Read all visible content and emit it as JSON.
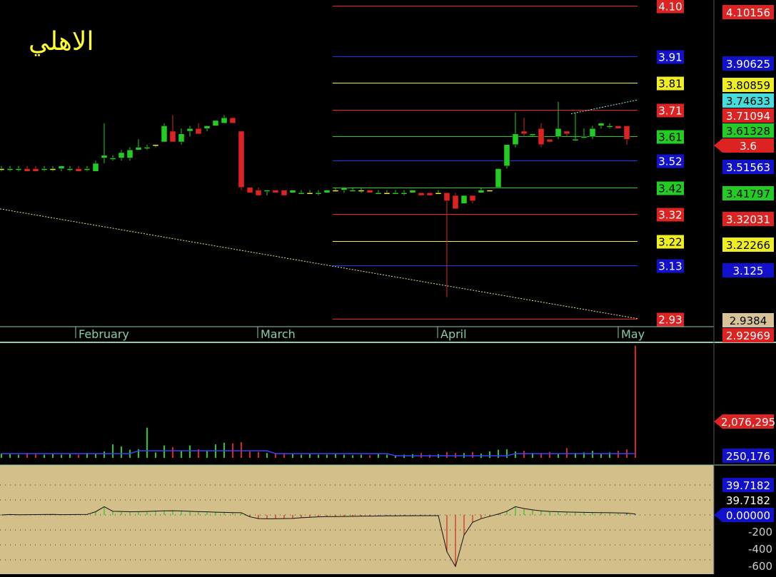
{
  "title": "الاهلي",
  "colors": {
    "up": "#22cc22",
    "down": "#dd2222",
    "axis": "#88ccaa",
    "panel_bg": "#000000",
    "osc_bg": "#d2bf8a",
    "blue": "#1111cc",
    "green": "#22cc22",
    "red": "#dd2222",
    "yellow": "#eeee22",
    "cyan": "#44dddd",
    "tan": "#d7c29a"
  },
  "chart_data": [
    {
      "type": "candlestick",
      "name": "price",
      "ylim": [
        2.9,
        4.12
      ],
      "x_labels": [
        "February",
        "March",
        "April",
        "May"
      ],
      "candles": [
        {
          "o": 3.49,
          "h": 3.5,
          "l": 3.48,
          "c": 3.49
        },
        {
          "o": 3.49,
          "h": 3.5,
          "l": 3.48,
          "c": 3.49
        },
        {
          "o": 3.49,
          "h": 3.5,
          "l": 3.48,
          "c": 3.49
        },
        {
          "o": 3.49,
          "h": 3.5,
          "l": 3.48,
          "c": 3.48
        },
        {
          "o": 3.49,
          "h": 3.5,
          "l": 3.48,
          "c": 3.48
        },
        {
          "o": 3.49,
          "h": 3.5,
          "l": 3.48,
          "c": 3.49
        },
        {
          "o": 3.49,
          "h": 3.5,
          "l": 3.48,
          "c": 3.49
        },
        {
          "o": 3.49,
          "h": 3.5,
          "l": 3.48,
          "c": 3.5
        },
        {
          "o": 3.49,
          "h": 3.5,
          "l": 3.48,
          "c": 3.49
        },
        {
          "o": 3.49,
          "h": 3.5,
          "l": 3.48,
          "c": 3.48
        },
        {
          "o": 3.49,
          "h": 3.5,
          "l": 3.48,
          "c": 3.49
        },
        {
          "o": 3.48,
          "h": 3.52,
          "l": 3.48,
          "c": 3.51
        },
        {
          "o": 3.53,
          "h": 3.66,
          "l": 3.51,
          "c": 3.54
        },
        {
          "o": 3.53,
          "h": 3.54,
          "l": 3.52,
          "c": 3.53
        },
        {
          "o": 3.53,
          "h": 3.56,
          "l": 3.52,
          "c": 3.55
        },
        {
          "o": 3.53,
          "h": 3.57,
          "l": 3.52,
          "c": 3.56
        },
        {
          "o": 3.56,
          "h": 3.6,
          "l": 3.56,
          "c": 3.57
        },
        {
          "o": 3.57,
          "h": 3.58,
          "l": 3.56,
          "c": 3.57
        },
        {
          "o": 3.58,
          "h": 3.58,
          "l": 3.57,
          "c": 3.58
        },
        {
          "o": 3.59,
          "h": 3.66,
          "l": 3.59,
          "c": 3.65
        },
        {
          "o": 3.63,
          "h": 3.69,
          "l": 3.61,
          "c": 3.59
        },
        {
          "o": 3.59,
          "h": 3.64,
          "l": 3.58,
          "c": 3.62
        },
        {
          "o": 3.63,
          "h": 3.65,
          "l": 3.61,
          "c": 3.64
        },
        {
          "o": 3.64,
          "h": 3.66,
          "l": 3.62,
          "c": 3.62
        },
        {
          "o": 3.64,
          "h": 3.65,
          "l": 3.63,
          "c": 3.65
        },
        {
          "o": 3.65,
          "h": 3.67,
          "l": 3.65,
          "c": 3.67
        },
        {
          "o": 3.66,
          "h": 3.69,
          "l": 3.66,
          "c": 3.68
        },
        {
          "o": 3.68,
          "h": 3.68,
          "l": 3.66,
          "c": 3.66
        },
        {
          "o": 3.63,
          "h": 3.63,
          "l": 3.41,
          "c": 3.42
        },
        {
          "o": 3.42,
          "h": 3.42,
          "l": 3.4,
          "c": 3.4
        },
        {
          "o": 3.41,
          "h": 3.42,
          "l": 3.39,
          "c": 3.39
        },
        {
          "o": 3.41,
          "h": 3.41,
          "l": 3.39,
          "c": 3.41
        },
        {
          "o": 3.41,
          "h": 3.41,
          "l": 3.4,
          "c": 3.4
        },
        {
          "o": 3.41,
          "h": 3.41,
          "l": 3.39,
          "c": 3.39
        },
        {
          "o": 3.4,
          "h": 3.41,
          "l": 3.4,
          "c": 3.41
        },
        {
          "o": 3.4,
          "h": 3.41,
          "l": 3.4,
          "c": 3.4
        },
        {
          "o": 3.4,
          "h": 3.41,
          "l": 3.4,
          "c": 3.4
        },
        {
          "o": 3.4,
          "h": 3.41,
          "l": 3.39,
          "c": 3.4
        },
        {
          "o": 3.4,
          "h": 3.41,
          "l": 3.4,
          "c": 3.41
        },
        {
          "o": 3.41,
          "h": 3.42,
          "l": 3.41,
          "c": 3.41
        },
        {
          "o": 3.41,
          "h": 3.42,
          "l": 3.4,
          "c": 3.42
        },
        {
          "o": 3.41,
          "h": 3.42,
          "l": 3.41,
          "c": 3.41
        },
        {
          "o": 3.41,
          "h": 3.42,
          "l": 3.4,
          "c": 3.41
        },
        {
          "o": 3.41,
          "h": 3.41,
          "l": 3.4,
          "c": 3.4
        },
        {
          "o": 3.4,
          "h": 3.41,
          "l": 3.4,
          "c": 3.4
        },
        {
          "o": 3.4,
          "h": 3.41,
          "l": 3.4,
          "c": 3.4
        },
        {
          "o": 3.4,
          "h": 3.41,
          "l": 3.4,
          "c": 3.4
        },
        {
          "o": 3.4,
          "h": 3.41,
          "l": 3.39,
          "c": 3.4
        },
        {
          "o": 3.4,
          "h": 3.41,
          "l": 3.4,
          "c": 3.41
        },
        {
          "o": 3.4,
          "h": 3.4,
          "l": 3.39,
          "c": 3.39
        },
        {
          "o": 3.4,
          "h": 3.4,
          "l": 3.39,
          "c": 3.39
        },
        {
          "o": 3.4,
          "h": 3.41,
          "l": 3.4,
          "c": 3.4
        },
        {
          "o": 3.4,
          "h": 3.4,
          "l": 3.01,
          "c": 3.37
        },
        {
          "o": 3.39,
          "h": 3.4,
          "l": 3.34,
          "c": 3.34
        },
        {
          "o": 3.36,
          "h": 3.39,
          "l": 3.36,
          "c": 3.39
        },
        {
          "o": 3.39,
          "h": 3.39,
          "l": 3.36,
          "c": 3.37
        },
        {
          "o": 3.4,
          "h": 3.42,
          "l": 3.4,
          "c": 3.41
        },
        {
          "o": 3.41,
          "h": 3.41,
          "l": 3.41,
          "c": 3.41
        },
        {
          "o": 3.42,
          "h": 3.49,
          "l": 3.42,
          "c": 3.49
        },
        {
          "o": 3.5,
          "h": 3.58,
          "l": 3.49,
          "c": 3.58
        },
        {
          "o": 3.58,
          "h": 3.7,
          "l": 3.57,
          "c": 3.62
        },
        {
          "o": 3.63,
          "h": 3.68,
          "l": 3.61,
          "c": 3.62
        },
        {
          "o": 3.62,
          "h": 3.62,
          "l": 3.61,
          "c": 3.62
        },
        {
          "o": 3.64,
          "h": 3.66,
          "l": 3.57,
          "c": 3.58
        },
        {
          "o": 3.6,
          "h": 3.6,
          "l": 3.59,
          "c": 3.59
        },
        {
          "o": 3.61,
          "h": 3.74,
          "l": 3.6,
          "c": 3.64
        },
        {
          "o": 3.63,
          "h": 3.63,
          "l": 3.61,
          "c": 3.62
        },
        {
          "o": 3.6,
          "h": 3.7,
          "l": 3.6,
          "c": 3.6
        },
        {
          "o": 3.61,
          "h": 3.64,
          "l": 3.61,
          "c": 3.61
        },
        {
          "o": 3.61,
          "h": 3.65,
          "l": 3.6,
          "c": 3.64
        },
        {
          "o": 3.65,
          "h": 3.66,
          "l": 3.64,
          "c": 3.66
        },
        {
          "o": 3.65,
          "h": 3.66,
          "l": 3.64,
          "c": 3.65
        },
        {
          "o": 3.65,
          "h": 3.65,
          "l": 3.64,
          "c": 3.64
        },
        {
          "o": 3.65,
          "h": 3.65,
          "l": 3.58,
          "c": 3.6
        }
      ],
      "levels": [
        {
          "label": "4.10",
          "color": "red"
        },
        {
          "label": "3.91",
          "color": "blue"
        },
        {
          "label": "3.81",
          "color": "yellow"
        },
        {
          "label": "3.71",
          "color": "red"
        },
        {
          "label": "3.61",
          "color": "green"
        },
        {
          "label": "3.52",
          "color": "blue"
        },
        {
          "label": "3.42",
          "color": "green"
        },
        {
          "label": "3.32",
          "color": "red"
        },
        {
          "label": "3.22",
          "color": "yellow"
        },
        {
          "label": "3.13",
          "color": "blue"
        },
        {
          "label": "2.93",
          "color": "red"
        }
      ],
      "right_scale": [
        {
          "label": "4.10156",
          "color": "red"
        },
        {
          "label": "3.90625",
          "color": "blue"
        },
        {
          "label": "3.80859",
          "color": "yellow"
        },
        {
          "label": "3.74633",
          "color": "cyan"
        },
        {
          "label": "3.71094",
          "color": "red"
        },
        {
          "label": "3.61328",
          "color": "green"
        },
        {
          "label": "3.6",
          "color": "red",
          "pointer": true
        },
        {
          "label": "3.51563",
          "color": "blue"
        },
        {
          "label": "3.41797",
          "color": "green"
        },
        {
          "label": "3.32031",
          "color": "red"
        },
        {
          "label": "3.22266",
          "color": "yellow"
        },
        {
          "label": "3.125",
          "color": "blue"
        },
        {
          "label": "2.9384",
          "color": "tan"
        },
        {
          "label": "2.92969",
          "color": "red"
        }
      ]
    },
    {
      "type": "bar",
      "name": "volume",
      "ylim": [
        0,
        2100000
      ],
      "volume_scale": [
        {
          "label": "2,076,295",
          "color": "red",
          "pointer": true
        },
        {
          "label": "250,176",
          "color": "blue"
        }
      ],
      "values": [
        80000,
        70000,
        60000,
        90000,
        70000,
        60000,
        80000,
        60000,
        70000,
        60000,
        90000,
        80000,
        120000,
        250000,
        210000,
        150000,
        160000,
        560000,
        100000,
        230000,
        200000,
        140000,
        230000,
        160000,
        130000,
        250000,
        280000,
        270000,
        290000,
        120000,
        110000,
        90000,
        80000,
        70000,
        80000,
        60000,
        70000,
        60000,
        60000,
        70000,
        60000,
        50000,
        60000,
        50000,
        70000,
        60000,
        50000,
        60000,
        70000,
        90000,
        60000,
        70000,
        110000,
        90000,
        90000,
        110000,
        80000,
        120000,
        150000,
        160000,
        120000,
        130000,
        90000,
        80000,
        110000,
        70000,
        180000,
        90000,
        100000,
        130000,
        80000,
        100000,
        130000,
        160000,
        2076295
      ],
      "ma_value": 250176
    },
    {
      "type": "bar",
      "name": "oscillator",
      "ylim": [
        -620,
        120
      ],
      "y_ticks": [
        {
          "label": "39.7182",
          "color": "blue"
        },
        {
          "label": "39.7182",
          "color": "black"
        },
        {
          "label": "0.00000",
          "color": "blue",
          "pointer": true
        },
        {
          "label": "-200",
          "color": "plain"
        },
        {
          "label": "-400",
          "color": "plain"
        },
        {
          "label": "-600",
          "color": "plain"
        }
      ],
      "values": [
        0,
        5,
        2,
        3,
        4,
        5,
        6,
        3,
        4,
        5,
        6,
        35,
        90,
        40,
        38,
        35,
        36,
        38,
        42,
        45,
        46,
        44,
        40,
        36,
        34,
        30,
        28,
        25,
        24,
        -20,
        -40,
        -42,
        -41,
        -40,
        -38,
        -30,
        -25,
        -20,
        -18,
        -17,
        -16,
        -15,
        -14,
        -13,
        -12,
        -10,
        -10,
        -9,
        -9,
        -8,
        -8,
        -8,
        -400,
        -560,
        -220,
        -80,
        -40,
        -15,
        10,
        40,
        90,
        70,
        55,
        45,
        38,
        35,
        32,
        30,
        28,
        26,
        25,
        24,
        22,
        20,
        10
      ]
    }
  ]
}
